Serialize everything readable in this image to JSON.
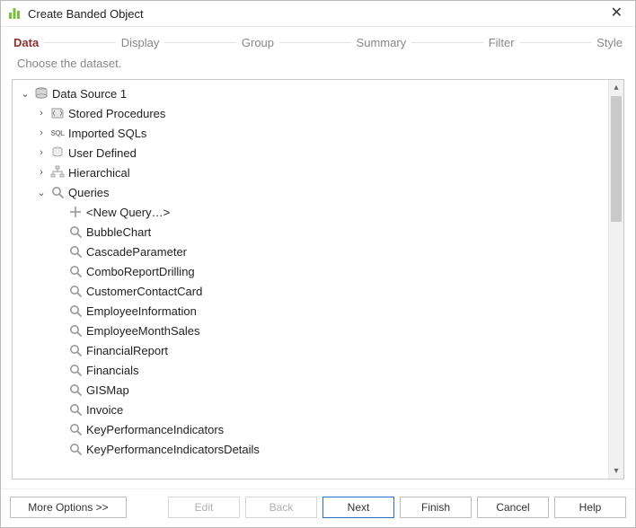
{
  "window": {
    "title": "Create Banded Object"
  },
  "steps": [
    "Data",
    "Display",
    "Group",
    "Summary",
    "Filter",
    "Style"
  ],
  "activeStep": 0,
  "subtitle": "Choose the dataset.",
  "tree": {
    "root": {
      "label": "Data Source 1",
      "children": [
        {
          "label": "Stored Procedures",
          "icon": "sp"
        },
        {
          "label": "Imported SQLs",
          "icon": "sql"
        },
        {
          "label": "User Defined",
          "icon": "ud"
        },
        {
          "label": "Hierarchical",
          "icon": "hier"
        }
      ],
      "queries": {
        "label": "Queries",
        "newQuery": "<New Query…>",
        "items": [
          "BubbleChart",
          "CascadeParameter",
          "ComboReportDrilling",
          "CustomerContactCard",
          "EmployeeInformation",
          "EmployeeMonthSales",
          "FinancialReport",
          "Financials",
          "GISMap",
          "Invoice",
          "KeyPerformanceIndicators",
          "KeyPerformanceIndicatorsDetails"
        ]
      }
    }
  },
  "buttons": {
    "moreOptions": "More Options >>",
    "edit": "Edit",
    "back": "Back",
    "next": "Next",
    "finish": "Finish",
    "cancel": "Cancel",
    "help": "Help"
  }
}
